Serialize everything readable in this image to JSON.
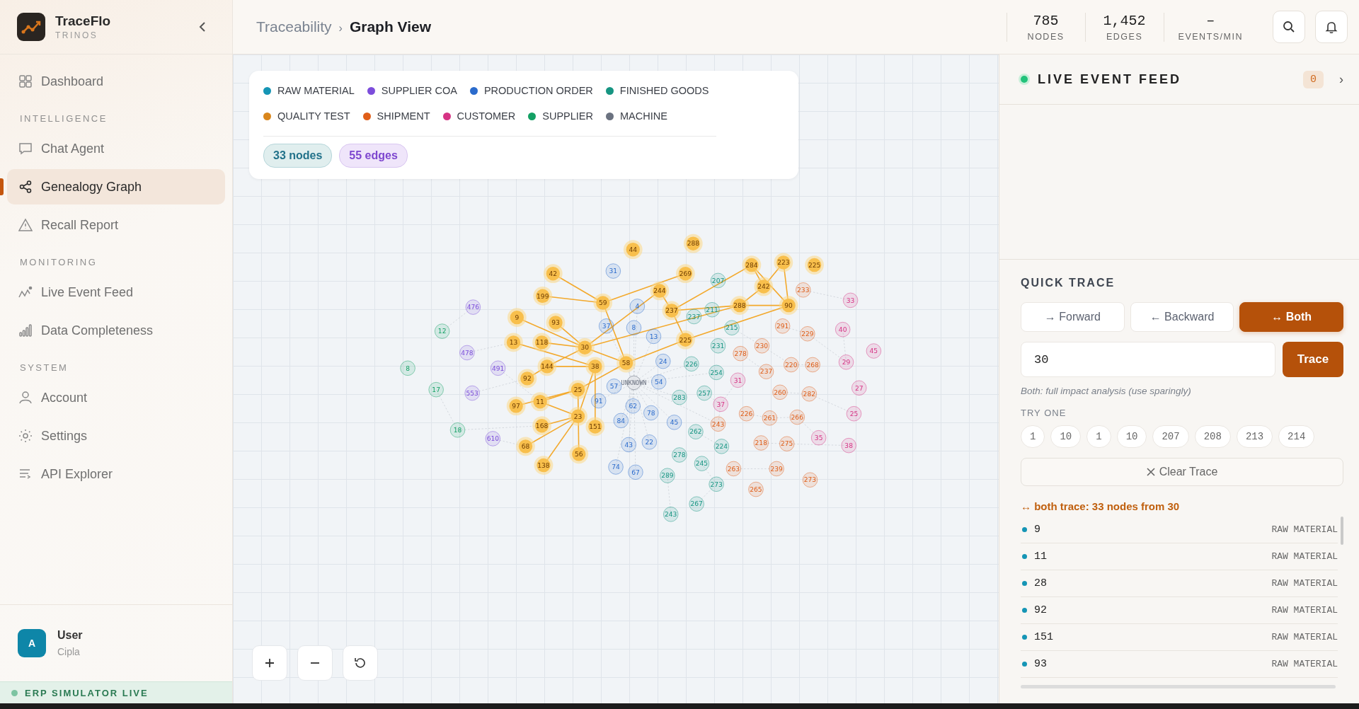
{
  "sidebar": {
    "brand": {
      "name": "TraceFlo",
      "subtitle": "TRINOS"
    },
    "sections": [
      {
        "items": [
          {
            "label": "Dashboard",
            "selected": false
          }
        ]
      },
      {
        "heading": "INTELLIGENCE",
        "items": [
          {
            "label": "Chat Agent",
            "selected": false
          },
          {
            "label": "Genealogy Graph",
            "selected": true
          },
          {
            "label": "Recall Report",
            "selected": false
          }
        ]
      },
      {
        "heading": "MONITORING",
        "items": [
          {
            "label": "Live Event Feed",
            "selected": false
          },
          {
            "label": "Data Completeness",
            "selected": false
          }
        ]
      },
      {
        "heading": "SYSTEM",
        "items": [
          {
            "label": "Account",
            "selected": false
          },
          {
            "label": "Settings",
            "selected": false
          },
          {
            "label": "API Explorer",
            "selected": false
          }
        ]
      }
    ],
    "user": {
      "initial": "A",
      "name": "User",
      "org": "Cipla"
    },
    "status": {
      "label": "ERP SIMULATOR LIVE",
      "live": true
    }
  },
  "header": {
    "breadcrumb": [
      "Traceability",
      "Graph View"
    ],
    "separator": "›",
    "stats": [
      {
        "value": "785",
        "label": "NODES"
      },
      {
        "value": "1,452",
        "label": "EDGES"
      },
      {
        "value": "–",
        "label": "EVENTS/MIN"
      }
    ]
  },
  "legend": {
    "items": [
      {
        "kind": "raw_material",
        "label": "RAW MATERIAL",
        "color": "#1595b5"
      },
      {
        "kind": "supplier_coa",
        "label": "SUPPLIER COA",
        "color": "#7c4ddb"
      },
      {
        "kind": "production_order",
        "label": "PRODUCTION ORDER",
        "color": "#2b6bcc"
      },
      {
        "kind": "finished_goods",
        "label": "FINISHED GOODS",
        "color": "#169582"
      },
      {
        "kind": "quality_test",
        "label": "QUALITY TEST",
        "color": "#d9861c"
      },
      {
        "kind": "shipment",
        "label": "SHIPMENT",
        "color": "#e05e18"
      },
      {
        "kind": "customer",
        "label": "CUSTOMER",
        "color": "#d63384"
      },
      {
        "kind": "supplier",
        "label": "SUPPLIER",
        "color": "#13a064"
      },
      {
        "kind": "machine",
        "label": "MACHINE",
        "color": "#6b7280"
      }
    ],
    "node_count": "33 nodes",
    "edge_count": "55 edges"
  },
  "graph": {
    "nodes": [
      {
        "label": "44",
        "kind": "raw_material",
        "highlighted": true
      },
      {
        "label": "288",
        "kind": "raw_material",
        "highlighted": true
      },
      {
        "label": "42",
        "kind": "raw_material",
        "highlighted": true
      },
      {
        "label": "199",
        "kind": "raw_material",
        "highlighted": true
      },
      {
        "label": "59",
        "kind": "raw_material",
        "highlighted": true
      },
      {
        "label": "9",
        "kind": "raw_material",
        "highlighted": true
      },
      {
        "label": "93",
        "kind": "raw_material",
        "highlighted": true
      },
      {
        "label": "13",
        "kind": "raw_material",
        "highlighted": true
      },
      {
        "label": "118",
        "kind": "raw_material",
        "highlighted": true
      },
      {
        "label": "30",
        "kind": "raw_material",
        "highlighted": true
      },
      {
        "label": "144",
        "kind": "raw_material",
        "highlighted": true
      },
      {
        "label": "38",
        "kind": "raw_material",
        "highlighted": true
      },
      {
        "label": "58",
        "kind": "raw_material",
        "highlighted": true
      },
      {
        "label": "92",
        "kind": "raw_material",
        "highlighted": true
      },
      {
        "label": "25",
        "kind": "raw_material",
        "highlighted": true
      },
      {
        "label": "97",
        "kind": "raw_material",
        "highlighted": true
      },
      {
        "label": "11",
        "kind": "raw_material",
        "highlighted": true
      },
      {
        "label": "23",
        "kind": "raw_material",
        "highlighted": true
      },
      {
        "label": "168",
        "kind": "raw_material",
        "highlighted": true
      },
      {
        "label": "151",
        "kind": "raw_material",
        "highlighted": true
      },
      {
        "label": "68",
        "kind": "raw_material",
        "highlighted": true
      },
      {
        "label": "56",
        "kind": "raw_material",
        "highlighted": true
      },
      {
        "label": "138",
        "kind": "raw_material",
        "highlighted": true
      },
      {
        "label": "269",
        "kind": "raw_material",
        "highlighted": true
      },
      {
        "label": "284",
        "kind": "raw_material",
        "highlighted": true
      },
      {
        "label": "223",
        "kind": "raw_material",
        "highlighted": true
      },
      {
        "label": "225",
        "kind": "raw_material",
        "highlighted": true
      },
      {
        "label": "244",
        "kind": "raw_material",
        "highlighted": true
      },
      {
        "label": "242",
        "kind": "raw_material",
        "highlighted": true
      },
      {
        "label": "237",
        "kind": "raw_material",
        "highlighted": true
      },
      {
        "label": "288",
        "kind": "raw_material",
        "highlighted": true
      },
      {
        "label": "90",
        "kind": "raw_material",
        "highlighted": true
      },
      {
        "label": "225",
        "kind": "raw_material",
        "highlighted": true
      },
      {
        "label": "31",
        "kind": "production_order",
        "highlighted": false
      },
      {
        "label": "476",
        "kind": "supplier_coa",
        "highlighted": false
      },
      {
        "label": "12",
        "kind": "supplier",
        "highlighted": false
      },
      {
        "label": "478",
        "kind": "supplier_coa",
        "highlighted": false
      },
      {
        "label": "8",
        "kind": "supplier",
        "highlighted": false
      },
      {
        "label": "491",
        "kind": "supplier_coa",
        "highlighted": false
      },
      {
        "label": "17",
        "kind": "supplier",
        "highlighted": false
      },
      {
        "label": "553",
        "kind": "supplier_coa",
        "highlighted": false
      },
      {
        "label": "18",
        "kind": "supplier",
        "highlighted": false
      },
      {
        "label": "610",
        "kind": "supplier_coa",
        "highlighted": false
      },
      {
        "label": "37",
        "kind": "production_order",
        "highlighted": false
      },
      {
        "label": "57",
        "kind": "production_order",
        "highlighted": false
      },
      {
        "label": "91",
        "kind": "production_order",
        "highlighted": false
      },
      {
        "label": "84",
        "kind": "production_order",
        "highlighted": false
      },
      {
        "label": "43",
        "kind": "production_order",
        "highlighted": false
      },
      {
        "label": "74",
        "kind": "production_order",
        "highlighted": false
      },
      {
        "label": "207",
        "kind": "finished_goods",
        "highlighted": false
      },
      {
        "label": "233",
        "kind": "shipment",
        "highlighted": false
      },
      {
        "label": "4",
        "kind": "production_order",
        "highlighted": false
      },
      {
        "label": "211",
        "kind": "finished_goods",
        "highlighted": false
      },
      {
        "label": "237",
        "kind": "finished_goods",
        "highlighted": false
      },
      {
        "label": "33",
        "kind": "customer",
        "highlighted": false
      },
      {
        "label": "8",
        "kind": "production_order",
        "highlighted": false
      },
      {
        "label": "13",
        "kind": "production_order",
        "highlighted": false
      },
      {
        "label": "215",
        "kind": "finished_goods",
        "highlighted": false
      },
      {
        "label": "291",
        "kind": "shipment",
        "highlighted": false
      },
      {
        "label": "229",
        "kind": "shipment",
        "highlighted": false
      },
      {
        "label": "40",
        "kind": "customer",
        "highlighted": false
      },
      {
        "label": "231",
        "kind": "finished_goods",
        "highlighted": false
      },
      {
        "label": "230",
        "kind": "shipment",
        "highlighted": false
      },
      {
        "label": "278",
        "kind": "shipment",
        "highlighted": false
      },
      {
        "label": "45",
        "kind": "customer",
        "highlighted": false
      },
      {
        "label": "24",
        "kind": "production_order",
        "highlighted": false
      },
      {
        "label": "226",
        "kind": "finished_goods",
        "highlighted": false
      },
      {
        "label": "237",
        "kind": "shipment",
        "highlighted": false
      },
      {
        "label": "220",
        "kind": "shipment",
        "highlighted": false
      },
      {
        "label": "268",
        "kind": "shipment",
        "highlighted": false
      },
      {
        "label": "29",
        "kind": "customer",
        "highlighted": false
      },
      {
        "label": "254",
        "kind": "finished_goods",
        "highlighted": false
      },
      {
        "label": "UNKNOWN",
        "kind": "machine",
        "highlighted": false
      },
      {
        "label": "54",
        "kind": "production_order",
        "highlighted": false
      },
      {
        "label": "31",
        "kind": "customer",
        "highlighted": false
      },
      {
        "label": "27",
        "kind": "customer",
        "highlighted": false
      },
      {
        "label": "283",
        "kind": "finished_goods",
        "highlighted": false
      },
      {
        "label": "257",
        "kind": "finished_goods",
        "highlighted": false
      },
      {
        "label": "260",
        "kind": "shipment",
        "highlighted": false
      },
      {
        "label": "282",
        "kind": "shipment",
        "highlighted": false
      },
      {
        "label": "62",
        "kind": "production_order",
        "highlighted": false
      },
      {
        "label": "37",
        "kind": "customer",
        "highlighted": false
      },
      {
        "label": "78",
        "kind": "production_order",
        "highlighted": false
      },
      {
        "label": "226",
        "kind": "shipment",
        "highlighted": false
      },
      {
        "label": "261",
        "kind": "shipment",
        "highlighted": false
      },
      {
        "label": "266",
        "kind": "shipment",
        "highlighted": false
      },
      {
        "label": "25",
        "kind": "customer",
        "highlighted": false
      },
      {
        "label": "45",
        "kind": "production_order",
        "highlighted": false
      },
      {
        "label": "243",
        "kind": "shipment",
        "highlighted": false
      },
      {
        "label": "262",
        "kind": "finished_goods",
        "highlighted": false
      },
      {
        "label": "22",
        "kind": "production_order",
        "highlighted": false
      },
      {
        "label": "224",
        "kind": "finished_goods",
        "highlighted": false
      },
      {
        "label": "218",
        "kind": "shipment",
        "highlighted": false
      },
      {
        "label": "275",
        "kind": "shipment",
        "highlighted": false
      },
      {
        "label": "35",
        "kind": "customer",
        "highlighted": false
      },
      {
        "label": "38",
        "kind": "customer",
        "highlighted": false
      },
      {
        "label": "278",
        "kind": "finished_goods",
        "highlighted": false
      },
      {
        "label": "245",
        "kind": "finished_goods",
        "highlighted": false
      },
      {
        "label": "67",
        "kind": "production_order",
        "highlighted": false
      },
      {
        "label": "289",
        "kind": "finished_goods",
        "highlighted": false
      },
      {
        "label": "263",
        "kind": "shipment",
        "highlighted": false
      },
      {
        "label": "239",
        "kind": "shipment",
        "highlighted": false
      },
      {
        "label": "273",
        "kind": "finished_goods",
        "highlighted": false
      },
      {
        "label": "273",
        "kind": "shipment",
        "highlighted": false
      },
      {
        "label": "265",
        "kind": "shipment",
        "highlighted": false
      },
      {
        "label": "267",
        "kind": "finished_goods",
        "highlighted": false
      },
      {
        "label": "243",
        "kind": "finished_goods",
        "highlighted": false
      }
    ]
  },
  "live_feed": {
    "title": "LIVE EVENT FEED",
    "live": true,
    "count": "0",
    "chevron": "›"
  },
  "quick_trace": {
    "title": "QUICK TRACE",
    "directions": [
      {
        "label": "→ Forward",
        "selected": false
      },
      {
        "label": "← Backward",
        "selected": false
      },
      {
        "label": "↔ Both",
        "selected": true
      }
    ],
    "input": {
      "value": "30"
    },
    "button": "Trace",
    "hint": "Both: full impact analysis (use sparingly)",
    "try_label": "TRY ONE",
    "chips": [
      "1",
      "10",
      "1",
      "10",
      "207",
      "208",
      "213",
      "214"
    ],
    "clear": "Clear Trace",
    "summary": "↔ both trace: 33 nodes from 30",
    "results": [
      {
        "label": "9",
        "type": "RAW MATERIAL",
        "kind": "raw_material"
      },
      {
        "label": "11",
        "type": "RAW MATERIAL",
        "kind": "raw_material"
      },
      {
        "label": "28",
        "type": "RAW MATERIAL",
        "kind": "raw_material"
      },
      {
        "label": "92",
        "type": "RAW MATERIAL",
        "kind": "raw_material"
      },
      {
        "label": "151",
        "type": "RAW MATERIAL",
        "kind": "raw_material"
      },
      {
        "label": "93",
        "type": "RAW MATERIAL",
        "kind": "raw_material"
      }
    ]
  }
}
